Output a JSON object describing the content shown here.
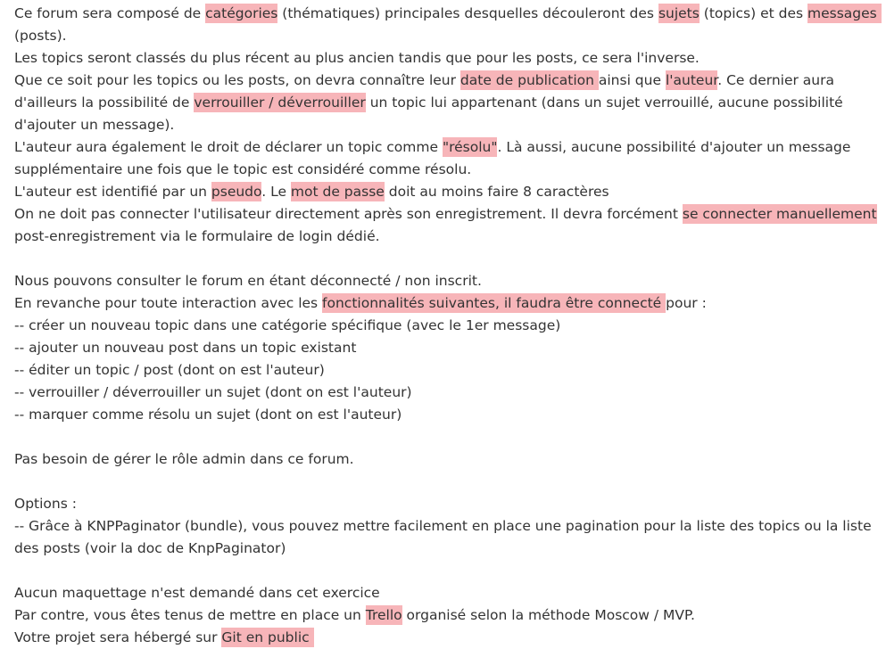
{
  "lines": [
    [
      {
        "t": "Ce forum sera composé de "
      },
      {
        "t": "catégories",
        "h": 1
      },
      {
        "t": " (thématiques) principales desquelles découleront des "
      },
      {
        "t": "sujets",
        "h": 1
      },
      {
        "t": " (topics) et des "
      },
      {
        "t": "messages ",
        "h": 1
      }
    ],
    [
      {
        "t": "(posts)."
      }
    ],
    [
      {
        "t": "Les topics seront classés du plus récent au plus ancien tandis que pour les posts, ce sera l'inverse."
      }
    ],
    [
      {
        "t": "Que ce soit pour les topics ou les posts, on devra connaître leur "
      },
      {
        "t": "date de publication ",
        "h": 1
      },
      {
        "t": "ainsi que "
      },
      {
        "t": "l'auteur",
        "h": 1
      },
      {
        "t": ". Ce dernier aura"
      }
    ],
    [
      {
        "t": "d'ailleurs la possibilité de "
      },
      {
        "t": "verrouiller / déverrouiller",
        "h": 1
      },
      {
        "t": " un topic lui appartenant (dans un sujet verrouillé, aucune possibilité"
      }
    ],
    [
      {
        "t": "d'ajouter un message)."
      }
    ],
    [
      {
        "t": "L'auteur aura également le droit de déclarer un topic comme "
      },
      {
        "t": "\"résolu\"",
        "h": 1
      },
      {
        "t": ". Là aussi, aucune possibilité d'ajouter un message"
      }
    ],
    [
      {
        "t": "supplémentaire une fois que le topic est considéré comme résolu."
      }
    ],
    [
      {
        "t": "L'auteur est identifié par un "
      },
      {
        "t": "pseudo",
        "h": 1
      },
      {
        "t": ". Le "
      },
      {
        "t": "mot de passe",
        "h": 1
      },
      {
        "t": " doit au moins faire 8 caractères"
      }
    ],
    [
      {
        "t": "On ne doit pas connecter l'utilisateur directement après son enregistrement. Il devra forcément "
      },
      {
        "t": "se connecter manuellement",
        "h": 1
      }
    ],
    [
      {
        "t": "post-enregistrement via le formulaire de login dédié."
      }
    ],
    [],
    [
      {
        "t": "Nous pouvons consulter le forum en étant déconnecté / non inscrit."
      }
    ],
    [
      {
        "t": "En revanche pour toute interaction avec les "
      },
      {
        "t": "fonctionnalités suivantes, il faudra être connecté ",
        "h": 1
      },
      {
        "t": "pour :"
      }
    ],
    [
      {
        "t": "-- créer un nouveau topic dans une catégorie spécifique (avec le 1er message)"
      }
    ],
    [
      {
        "t": "-- ajouter un nouveau post dans un topic existant"
      }
    ],
    [
      {
        "t": "-- éditer un topic / post (dont on est l'auteur)"
      }
    ],
    [
      {
        "t": "-- verrouiller / déverrouiller un sujet (dont on est l'auteur)"
      }
    ],
    [
      {
        "t": "-- marquer comme résolu un sujet (dont on est l'auteur)"
      }
    ],
    [],
    [
      {
        "t": "Pas besoin de gérer le rôle admin dans ce forum."
      }
    ],
    [],
    [
      {
        "t": "Options :"
      }
    ],
    [
      {
        "t": "-- Grâce à KNPPaginator (bundle), vous pouvez mettre facilement en place une pagination pour la liste des topics ou la liste"
      }
    ],
    [
      {
        "t": "des posts (voir la doc de KnpPaginator)"
      }
    ],
    [],
    [
      {
        "t": "Aucun maquettage n'est demandé dans cet exercice"
      }
    ],
    [
      {
        "t": "Par contre, vous êtes tenus de mettre en place un "
      },
      {
        "t": "Trello",
        "h": 1
      },
      {
        "t": " organisé selon la méthode Moscow / MVP."
      }
    ],
    [
      {
        "t": "Votre projet sera hébergé sur "
      },
      {
        "t": "Git en public ",
        "h": 1
      }
    ]
  ],
  "colors": {
    "text": "#333333",
    "highlight": "#f7b5b9"
  }
}
